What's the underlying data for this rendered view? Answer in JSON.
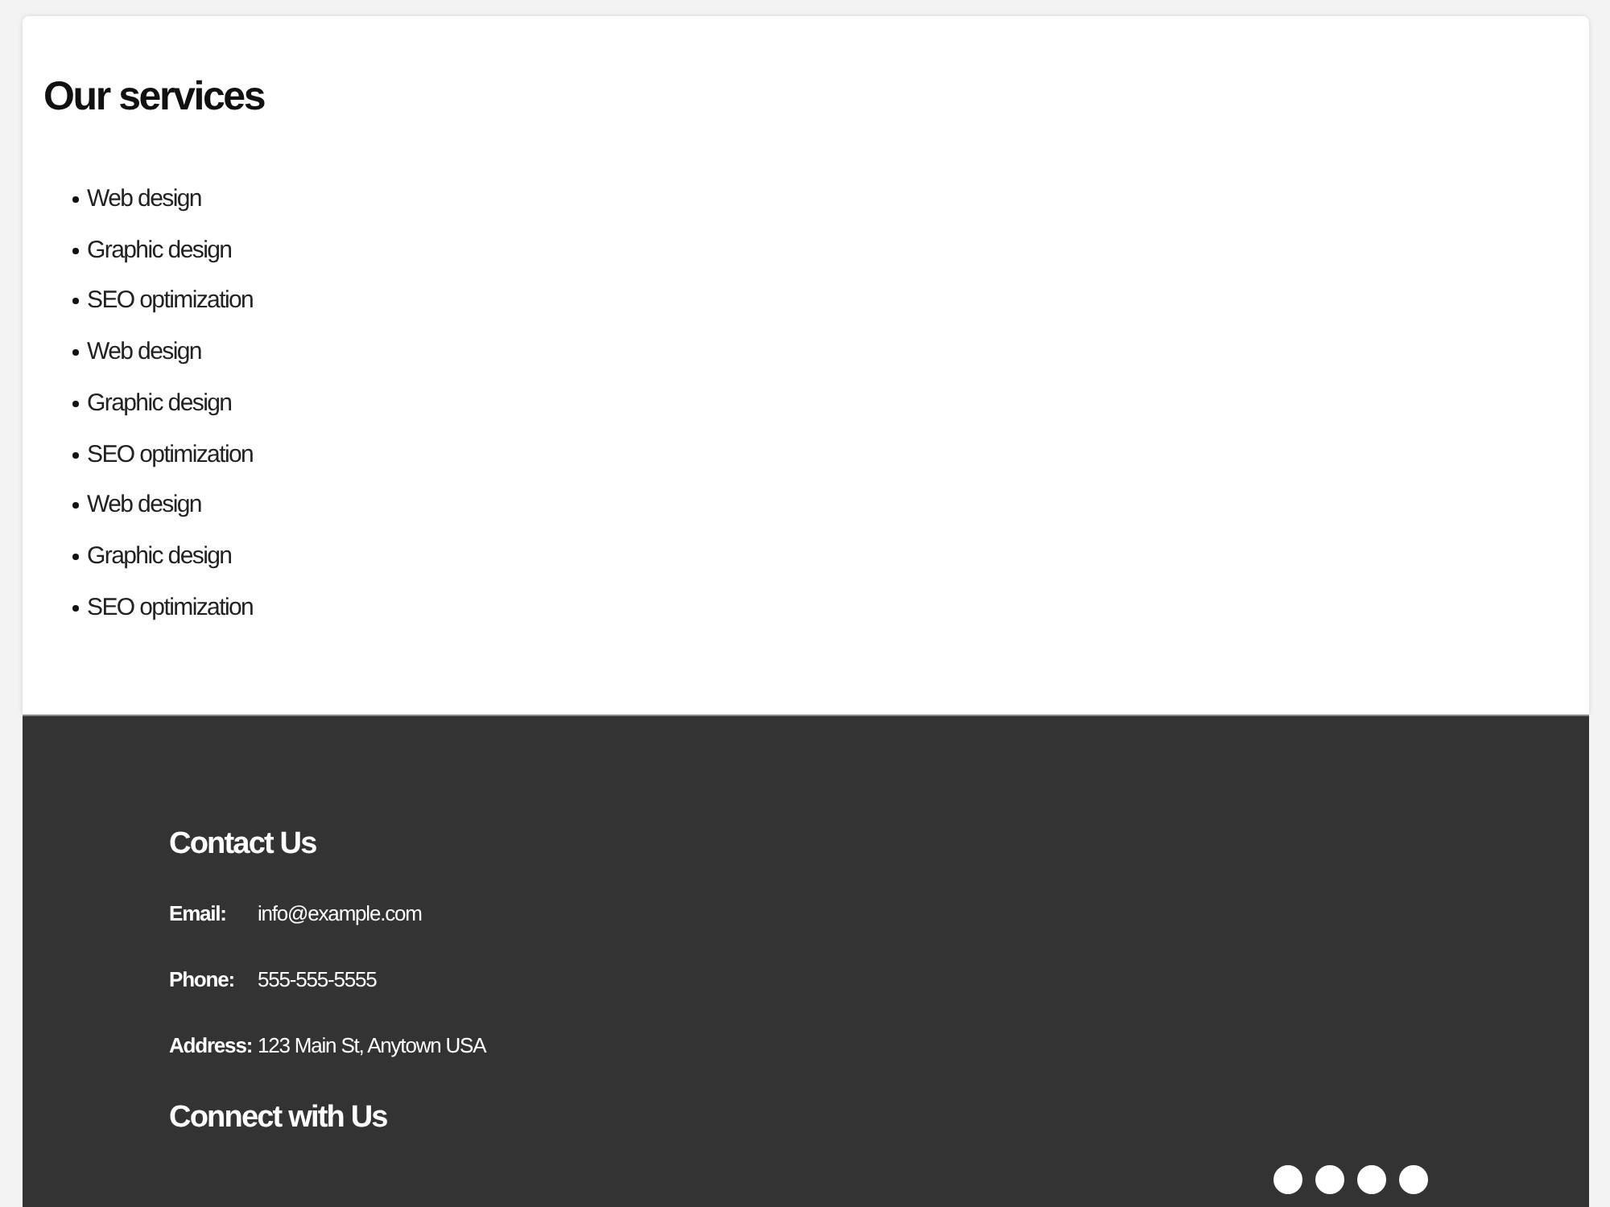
{
  "services_card": {
    "title": "Our services",
    "items": [
      "Web design",
      "Graphic design",
      "SEO optimization",
      "Web design",
      "Graphic design",
      "SEO optimization",
      "Web design",
      "Graphic design",
      "SEO optimization"
    ]
  },
  "footer": {
    "contact_heading": "Contact Us",
    "contact_rows": [
      {
        "label": "Email:",
        "value": "info@example.com"
      },
      {
        "label": "Phone:",
        "value": "555-555-5555"
      },
      {
        "label": "Address:",
        "value": "123 Main St, Anytown USA"
      }
    ],
    "connect_heading": "Connect with Us"
  }
}
